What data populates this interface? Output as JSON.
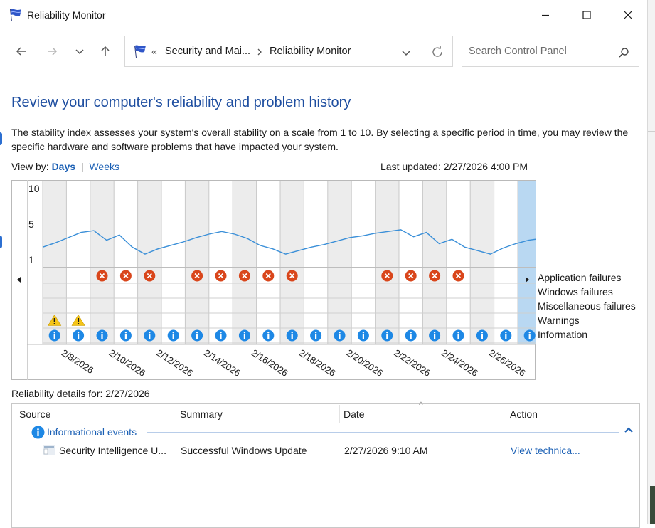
{
  "window": {
    "title": "Reliability Monitor"
  },
  "nav": {
    "breadcrumb_overflow": "«",
    "breadcrumbs": [
      "Security and Mai...",
      "Reliability Monitor"
    ],
    "breadcrumb_separator": "›"
  },
  "search": {
    "placeholder": "Search Control Panel",
    "value": ""
  },
  "page": {
    "title": "Review your computer's reliability and problem history",
    "description": "The stability index assesses your system's overall stability on a scale from 1 to 10. By selecting a specific period in time, you may review the specific hardware and software problems that have impacted your system.",
    "view_by_label": "View by:",
    "view_days": "Days",
    "view_separator": "|",
    "view_weeks": "Weeks",
    "last_updated": "Last updated: 2/27/2026 4:00 PM"
  },
  "chart_data": {
    "type": "line",
    "y_ticks": [
      "10",
      "5",
      "1"
    ],
    "ylim": [
      1,
      10
    ],
    "x_labels": [
      "2/8/2026",
      "2/10/2026",
      "2/12/2026",
      "2/14/2026",
      "2/16/2026",
      "2/18/2026",
      "2/20/2026",
      "2/22/2026",
      "2/24/2026",
      "2/26/2026"
    ],
    "days": [
      "2/7",
      "2/8",
      "2/9",
      "2/10",
      "2/11",
      "2/12",
      "2/13",
      "2/14",
      "2/15",
      "2/16",
      "2/17",
      "2/18",
      "2/19",
      "2/20",
      "2/21",
      "2/22",
      "2/23",
      "2/24",
      "2/25",
      "2/26"
    ],
    "selected_day": "2/27",
    "stability_index": [
      3.1,
      3.6,
      4.2,
      4.8,
      5.0,
      3.9,
      4.5,
      3.1,
      2.3,
      2.9,
      3.3,
      3.7,
      4.2,
      4.6,
      4.9,
      4.6,
      4.1,
      3.3,
      2.9,
      2.3,
      2.7,
      3.1,
      3.4,
      3.8,
      4.2,
      4.4,
      4.7,
      4.9,
      5.1,
      4.3,
      4.8,
      3.5,
      4.0,
      3.1,
      2.7,
      2.3,
      3.0,
      3.5,
      3.9,
      4.1
    ],
    "stability_index_note": "sampled twice per day, 2/7 through the selected day",
    "rows": [
      "Application failures",
      "Windows failures",
      "Miscellaneous failures",
      "Warnings",
      "Information"
    ],
    "application_failures": [
      0,
      0,
      1,
      1,
      1,
      0,
      1,
      1,
      1,
      1,
      1,
      0,
      0,
      0,
      1,
      1,
      1,
      1,
      0,
      0
    ],
    "windows_failures": [
      0,
      0,
      0,
      0,
      0,
      0,
      0,
      0,
      0,
      0,
      0,
      0,
      0,
      0,
      0,
      0,
      0,
      0,
      0,
      0
    ],
    "miscellaneous_failures": [
      0,
      0,
      0,
      0,
      0,
      0,
      0,
      0,
      0,
      0,
      0,
      0,
      0,
      0,
      0,
      0,
      0,
      0,
      0,
      0
    ],
    "warnings": [
      1,
      1,
      0,
      0,
      0,
      0,
      0,
      0,
      0,
      0,
      0,
      0,
      0,
      0,
      0,
      0,
      0,
      0,
      0,
      0
    ],
    "information": [
      1,
      1,
      1,
      1,
      1,
      1,
      1,
      1,
      1,
      1,
      1,
      1,
      1,
      1,
      1,
      1,
      1,
      1,
      1,
      1,
      1
    ],
    "grid": true
  },
  "details": {
    "label": "Reliability details for: 2/27/2026",
    "columns": [
      "Source",
      "Summary",
      "Date",
      "Action"
    ],
    "group": "Informational events",
    "rows": [
      {
        "source": "Security Intelligence U...",
        "summary": "Successful Windows Update",
        "date": "2/27/2026 9:10 AM",
        "action": "View technica..."
      }
    ]
  },
  "colors": {
    "accent": "#1a5fb4",
    "title_blue": "#1e4ea0",
    "error_red": "#d9461b",
    "warning_yellow": "#f5c518",
    "info_blue": "#1e88e5",
    "selected_column": "#b9d8f2",
    "shaded_column": "#ececec",
    "line": "#3a8fd8"
  }
}
